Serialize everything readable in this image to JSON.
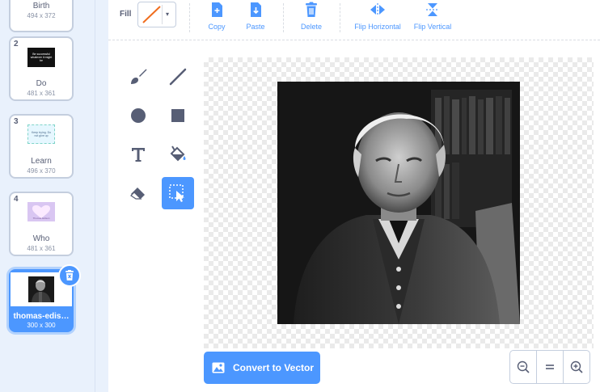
{
  "costumes": [
    {
      "num": "",
      "name": "Birth",
      "size": "494 x 372"
    },
    {
      "num": "2",
      "name": "Do",
      "size": "481 x 361",
      "thumb_text": "Be successful whatever it might be"
    },
    {
      "num": "3",
      "name": "Learn",
      "size": "496 x 370",
      "thumb_text": "Keep trying. Do not give up"
    },
    {
      "num": "4",
      "name": "Who",
      "size": "481 x 361",
      "thumb_text": "Thomas Edison"
    },
    {
      "num": "5",
      "name": "thomas-edis…",
      "size": "300 x 300"
    }
  ],
  "toolbar": {
    "fill_label": "Fill",
    "fill_color": "#f06d1e",
    "actions": {
      "copy": "Copy",
      "paste": "Paste",
      "delete": "Delete",
      "flip_h": "Flip Horizontal",
      "flip_v": "Flip Vertical"
    }
  },
  "tools": [
    "brush",
    "line",
    "circle",
    "rectangle",
    "text",
    "fill",
    "eraser",
    "select"
  ],
  "active_tool": "select",
  "convert_button": "Convert to Vector",
  "zoom": {
    "out": "zoom-out",
    "reset": "zoom-reset",
    "in": "zoom-in"
  },
  "colors": {
    "accent": "#4c97ff",
    "text": "#575e75"
  }
}
